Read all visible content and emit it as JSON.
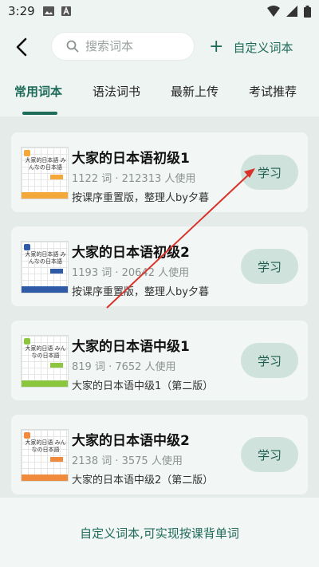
{
  "status_bar": {
    "time": "3:29"
  },
  "header": {
    "search_placeholder": "搜索词本",
    "custom_label": "自定义词本"
  },
  "tabs": [
    {
      "label": "常用词本"
    },
    {
      "label": "语法词书"
    },
    {
      "label": "最新上传"
    },
    {
      "label": "考试推荐"
    }
  ],
  "books": [
    {
      "title": "大家的日本语初级1",
      "meta": "1122 词 · 212313 人使用",
      "desc": "按课序重置版，整理人by夕暮",
      "button": "学习",
      "cover_text": "大家的日本語 みんなの日本語",
      "cover_color": "#f4a83a"
    },
    {
      "title": "大家的日本语初级2",
      "meta": "1193 词 · 20642 人使用",
      "desc": "按课序重置版，整理人by夕暮",
      "button": "学习",
      "cover_text": "大家的日本語 みんなの日本語",
      "cover_color": "#2f5aa8"
    },
    {
      "title": "大家的日本语中级1",
      "meta": "819 词 · 7652 人使用",
      "desc": "大家的日本语中级1（第二版）",
      "button": "学习",
      "cover_text": "大家的日语 みんなの日本語",
      "cover_color": "#8cc63f"
    },
    {
      "title": "大家的日本语中级2",
      "meta": "2138 词 · 3575 人使用",
      "desc": "大家的日本语中级2（第二版）",
      "button": "学习",
      "cover_text": "大家的日语 みんなの日本語",
      "cover_color": "#f08a3c"
    }
  ],
  "footer": {
    "link": "自定义词本,可实现按课背单词"
  },
  "colors": {
    "accent": "#1f6b5a",
    "annotation_arrow": "#d8322b"
  }
}
